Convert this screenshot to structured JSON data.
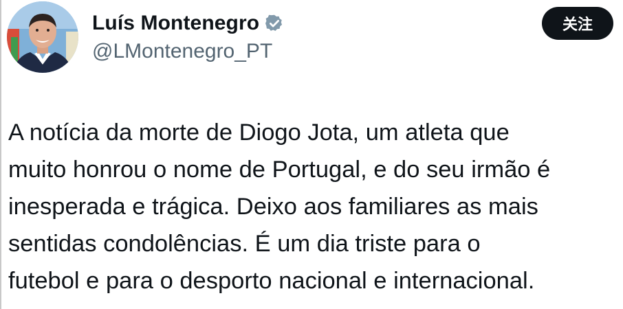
{
  "author": {
    "display_name": "Luís Montenegro",
    "handle": "@LMontenegro_PT",
    "verified_icon": "verified-badge-icon",
    "verified_color": "#829aab"
  },
  "follow_button": {
    "label": "关注",
    "background": "#0f1419",
    "color": "#ffffff"
  },
  "tweet": {
    "lines": [
      "A notícia da morte de Diogo Jota, um atleta que",
      "muito honrou o nome de Portugal, e do seu irmão é",
      "inesperada e trágica. Deixo aos familiares as mais",
      "sentidas condolências. É um dia triste para o",
      "futebol e para o desporto nacional e internacional."
    ]
  }
}
